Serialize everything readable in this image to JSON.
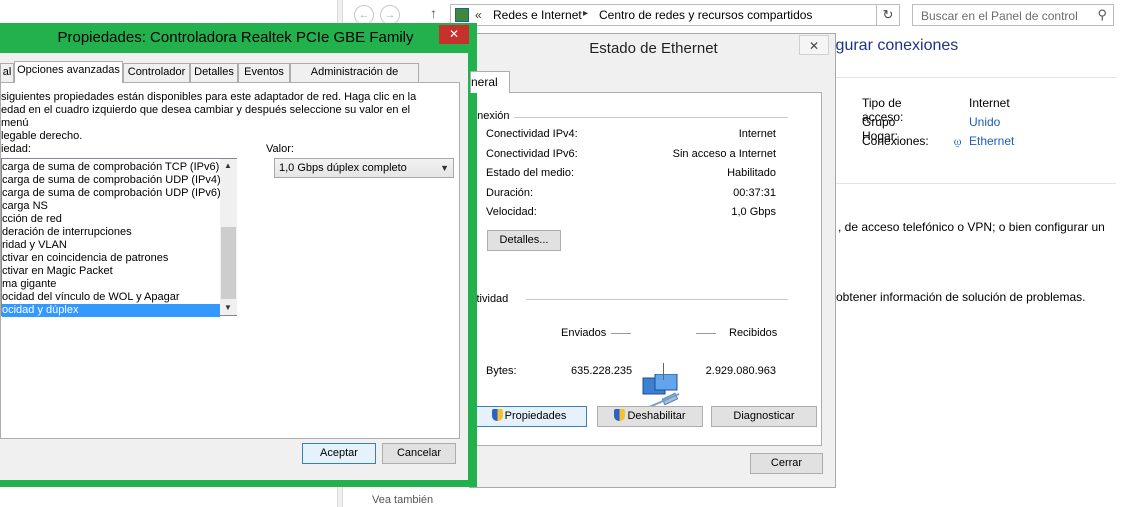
{
  "control_panel": {
    "address": {
      "crumbs": [
        "Redes e Internet",
        "Centro de redes y recursos compartidos"
      ],
      "search_placeholder": "Buscar en el Panel de control"
    },
    "heading_tail": "igurar conexiones",
    "info": {
      "rows": [
        {
          "key": "Tipo de acceso:",
          "value": "Internet"
        },
        {
          "key": "Grupo Hogar:",
          "value": "Unido"
        },
        {
          "key": "Conexiones:",
          "value": "Ethernet"
        }
      ]
    },
    "text1": ", de acceso telefónico o VPN; o bien configurar un",
    "text2": "u obtener información de solución de problemas.",
    "see_also": "Vea también"
  },
  "status_dialog": {
    "title": "Estado de Ethernet",
    "tab": "neral",
    "connection_group": "onexión",
    "rows": [
      {
        "key": "Conectividad IPv4:",
        "value": "Internet"
      },
      {
        "key": "Conectividad IPv6:",
        "value": "Sin acceso a Internet"
      },
      {
        "key": "Estado del medio:",
        "value": "Habilitado"
      },
      {
        "key": "Duración:",
        "value": "00:37:31"
      },
      {
        "key": "Velocidad:",
        "value": "1,0 Gbps"
      }
    ],
    "details_button": "Detalles...",
    "activity_group": "ctividad",
    "sent_label": "Enviados",
    "received_label": "Recibidos",
    "bytes_label": "Bytes:",
    "bytes_sent": "635.228.235",
    "bytes_received": "2.929.080.963",
    "buttons": {
      "properties": "Propiedades",
      "disable": "Deshabilitar",
      "diagnose": "Diagnosticar",
      "close": "Cerrar"
    }
  },
  "properties_dialog": {
    "title": "Propiedades: Controladora Realtek PCIe GBE Family",
    "tabs": [
      "al",
      "Opciones avanzadas",
      "Controlador",
      "Detalles",
      "Eventos",
      "Administración de energía"
    ],
    "description": [
      "siguientes propiedades están disponibles para este adaptador de red. Haga clic en la",
      "edad en el cuadro izquierdo que desea cambiar y después seleccione su valor en el menú",
      "legable derecho."
    ],
    "property_label": "iedad:",
    "value_label": "Valor:",
    "properties": [
      "carga de suma de comprobación TCP (IPv6)",
      "carga de suma de comprobación UDP (IPv4)",
      "carga de suma de comprobación UDP (IPv6)",
      "carga NS",
      "cción de red",
      "deración de interrupciones",
      "ridad y VLAN",
      "ctivar en coincidencia de patrones",
      "ctivar en Magic Packet",
      "ma gigante",
      "ocidad del vínculo de WOL y Apagar",
      "ocidad y dúplex"
    ],
    "selected_value": "1,0 Gbps dúplex completo",
    "ok": "Aceptar",
    "cancel": "Cancelar"
  }
}
